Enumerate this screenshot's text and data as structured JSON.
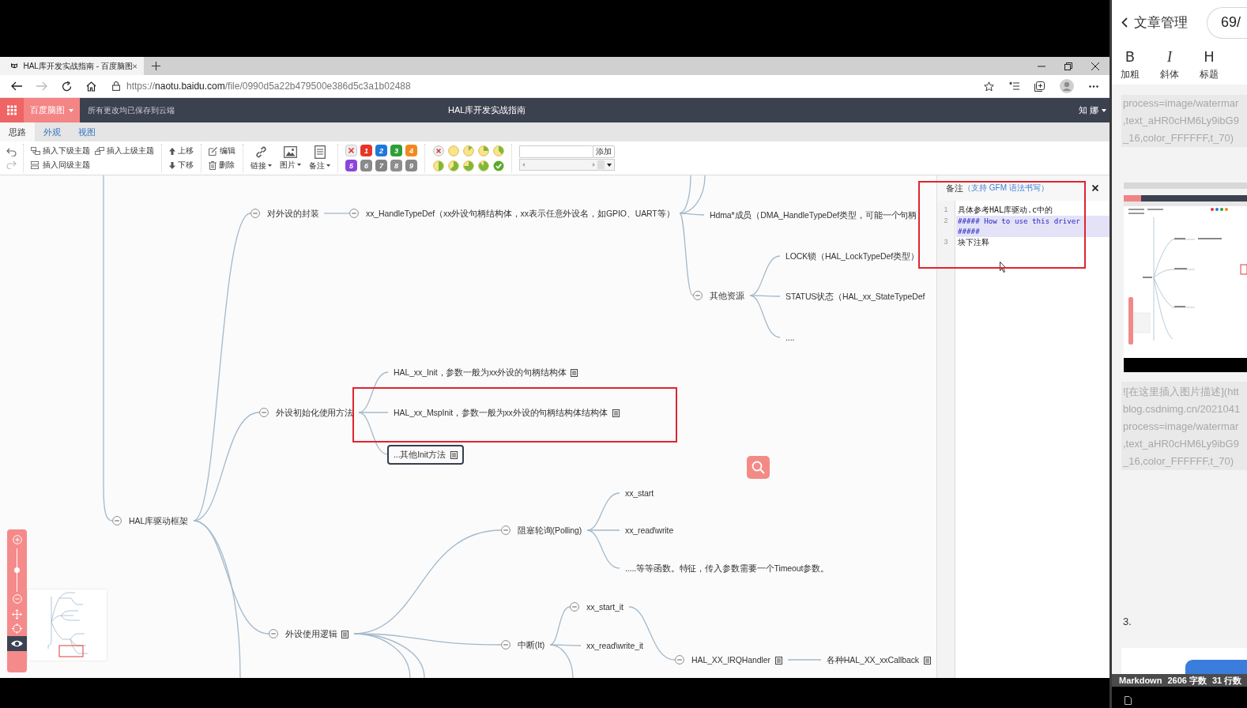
{
  "browser": {
    "tab_title": "HAL库开发实战指南 - 百度脑图",
    "url": {
      "scheme": "https://",
      "host": "naotu.baidu.com",
      "path": "/file/0990d5a22b479500e386d5c3a1b02488"
    }
  },
  "app_header": {
    "brand": "百度脑图",
    "save_status": "所有更改均已保存到云端",
    "title": "HAL库开发实战指南",
    "user": "知 娜"
  },
  "tabs": [
    {
      "label": "思路",
      "selected": true
    },
    {
      "label": "外观",
      "selected": false
    },
    {
      "label": "视图",
      "selected": false
    }
  ],
  "toolbar": {
    "insert_child": "插入下级主题",
    "insert_parent": "插入上级主题",
    "insert_sibling": "插入同级主题",
    "move_up": "上移",
    "move_down": "下移",
    "edit": "编辑",
    "delete": "删除",
    "menus": [
      {
        "label": "链接",
        "kind": "link"
      },
      {
        "label": "图片",
        "kind": "image"
      },
      {
        "label": "备注",
        "kind": "note"
      }
    ],
    "priorities": [
      {
        "label": "1",
        "color": "#e53528"
      },
      {
        "label": "2",
        "color": "#1f78d8"
      },
      {
        "label": "3",
        "color": "#2e9e36"
      },
      {
        "label": "4",
        "color": "#f0891e"
      },
      {
        "label": "5",
        "color": "#8c45d9"
      },
      {
        "label": "6",
        "color": "#8a8a8a"
      },
      {
        "label": "7",
        "color": "#848484"
      },
      {
        "label": "8",
        "color": "#8e8e8e"
      },
      {
        "label": "9",
        "color": "#888888"
      }
    ],
    "tag_button": "添加"
  },
  "mindmap": {
    "root": {
      "text": "HAL库驱动框架",
      "selected": false,
      "has_note": false,
      "expanded": true,
      "children": [
        {
          "text": "对外设的封装",
          "selected": false,
          "has_note": false,
          "expanded": true,
          "children": [
            {
              "text": "xx_HandleTypeDef（xx外设句柄结构体，xx表示任意外设名，如GPIO、UART等）",
              "selected": false,
              "has_note": false,
              "expanded": true,
              "children": [
                {
                  "text": "Hdma*成员（DMA_HandleTypeDef类型，可能一个句柄",
                  "selected": false,
                  "has_note": false
                },
                {
                  "text": "其他资源",
                  "selected": false,
                  "has_note": false,
                  "expanded": true,
                  "children": [
                    {
                      "text": "LOCK锁（HAL_LockTypeDef类型）",
                      "selected": false,
                      "has_note": false
                    },
                    {
                      "text": "STATUS状态（HAL_xx_StateTypeDef",
                      "selected": false,
                      "has_note": false
                    },
                    {
                      "text": "....",
                      "selected": false,
                      "has_note": false
                    }
                  ]
                }
              ]
            }
          ]
        },
        {
          "text": "外设初始化使用方法",
          "selected": false,
          "has_note": false,
          "expanded": true,
          "children": [
            {
              "text": "HAL_xx_Init，参数一般为xx外设的句柄结构体",
              "selected": false,
              "has_note": true
            },
            {
              "text": "HAL_xx_MspInit，参数一般为xx外设的句柄结构体结构体",
              "selected": false,
              "has_note": true
            },
            {
              "text": "...其他Init方法",
              "selected": true,
              "has_note": true
            }
          ]
        },
        {
          "text": "外设使用逻辑",
          "selected": false,
          "has_note": true,
          "expanded": true,
          "children": [
            {
              "text": "阻塞轮询(Polling)",
              "selected": false,
              "has_note": false,
              "expanded": true,
              "children": [
                {
                  "text": "xx_start",
                  "selected": false,
                  "has_note": false
                },
                {
                  "text": "xx_read\\write",
                  "selected": false,
                  "has_note": false
                },
                {
                  "text": ".....等等函数。特征，传入参数需要一个Timeout参数。",
                  "selected": false,
                  "has_note": false
                }
              ]
            },
            {
              "text": "中断(It)",
              "selected": false,
              "has_note": false,
              "expanded": true,
              "children": [
                {
                  "text": "xx_start_it",
                  "selected": false,
                  "has_note": false,
                  "expanded": true,
                  "children": [
                    {
                      "text": "HAL_XX_IRQHandler",
                      "selected": false,
                      "has_note": true,
                      "expanded": true,
                      "children": [
                        {
                          "text": "各种HAL_XX_xxCallback",
                          "selected": false,
                          "has_note": true
                        }
                      ]
                    }
                  ]
                },
                {
                  "text": "xx_read\\write_it",
                  "selected": false,
                  "has_note": false
                }
              ]
            }
          ]
        }
      ]
    }
  },
  "zoom": {
    "level": 0.5
  },
  "note_panel": {
    "title": "备注",
    "hint": "（支持 GFM 语法书写）",
    "lines": [
      {
        "number": "1",
        "text": "具体参考HAL库驱动.c中的",
        "kind": "text",
        "selected": false
      },
      {
        "number": "2",
        "text": "##### How to use this driver #####",
        "kind": "heading",
        "selected": true
      },
      {
        "number": "3",
        "text": "块下注释",
        "kind": "text",
        "selected": false
      }
    ]
  },
  "editor": {
    "back": "文章管理",
    "counter": "69/",
    "tools": [
      {
        "glyph": "B",
        "label": "加粗",
        "kind": "bold"
      },
      {
        "glyph": "I",
        "label": "斜体",
        "kind": "italic"
      },
      {
        "glyph": "H",
        "label": "标题",
        "kind": "heading"
      }
    ],
    "blocks": [
      {
        "kind": "code",
        "lines": [
          "process=image/watermar",
          ",text_aHR0cHM6Ly9ibG9",
          "_16,color_FFFFFF,t_70)"
        ]
      },
      {
        "kind": "image"
      },
      {
        "kind": "code",
        "lines": [
          "![在这里插入图片描述](htt",
          "blog.csdnimg.cn/2021041",
          "process=image/watermar",
          ",text_aHR0cHM6Ly9ibG9",
          "_16,color_FFFFFF,t_70)"
        ]
      },
      {
        "kind": "text",
        "lines": [
          "3."
        ]
      }
    ],
    "status": [
      "Markdown",
      "2606 字数",
      "31 行数"
    ]
  }
}
